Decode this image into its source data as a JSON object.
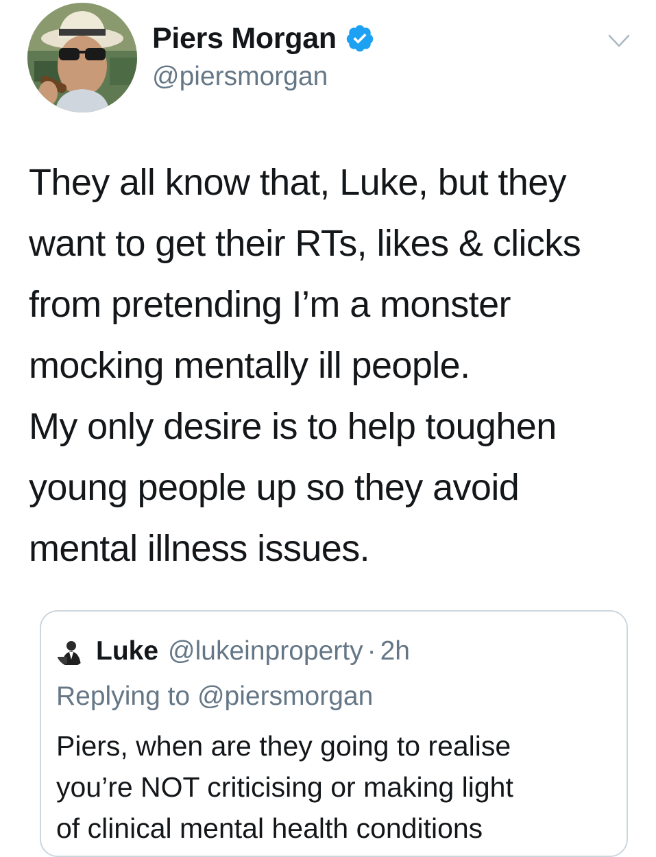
{
  "tweet": {
    "author": {
      "display_name": "Piers Morgan",
      "handle": "@piersmorgan",
      "verified": true,
      "avatar_icon": "user-avatar-photo"
    },
    "menu_icon": "chevron-down-icon",
    "text_lines": [
      "They all know that, Luke, but they",
      "want to get their RTs, likes & clicks",
      "from pretending I’m a monster",
      "mocking mentally ill people.",
      "My only desire is to help toughen",
      "young people up so they avoid",
      "mental illness issues."
    ]
  },
  "quoted_tweet": {
    "author": {
      "display_name": "Luke",
      "handle": "@lukeinproperty",
      "separator": "·",
      "time": "2h"
    },
    "replying_to": "Replying to @piersmorgan",
    "text_lines": [
      "Piers, when are they going to realise",
      "you’re NOT criticising or making light",
      "of clinical mental health conditions"
    ]
  },
  "colors": {
    "text_primary": "#14171a",
    "text_secondary": "#657786",
    "verified_blue": "#1da1f2",
    "border": "#ccd6dd"
  }
}
